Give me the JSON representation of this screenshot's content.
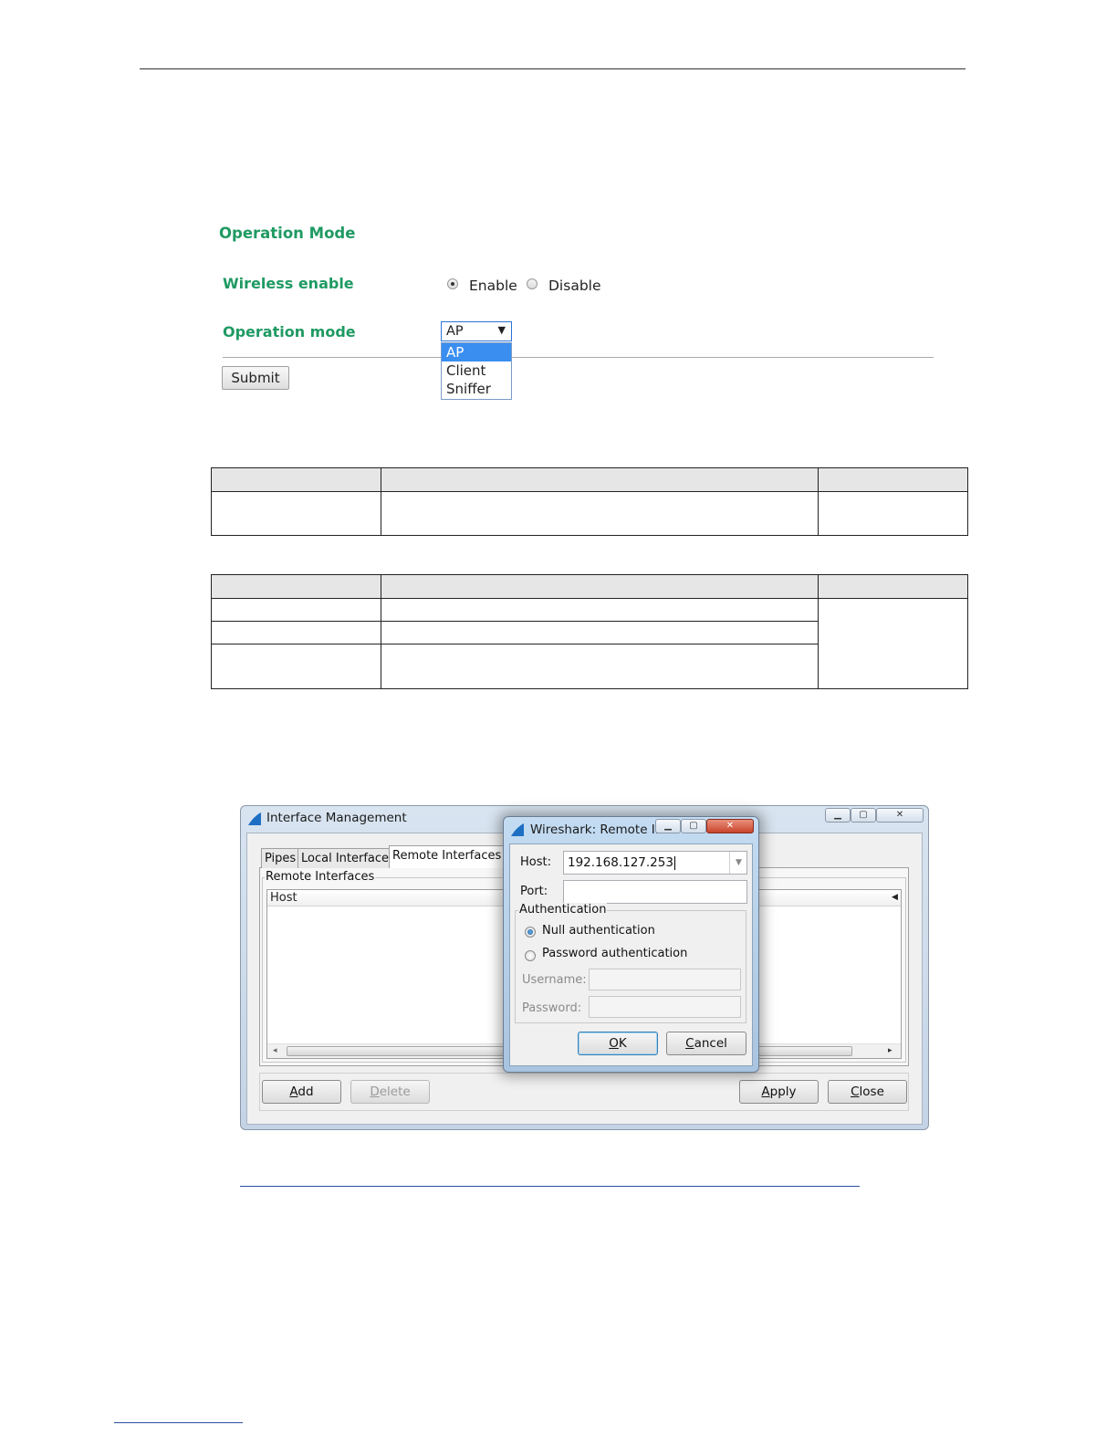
{
  "op_panel": {
    "title": "Operation Mode",
    "wireless_label": "Wireless enable",
    "enable_label": "Enable",
    "disable_label": "Disable",
    "wireless_selected": "Enable",
    "mode_label": "Operation mode",
    "mode_value": "AP",
    "mode_options": [
      "AP",
      "Client",
      "Sniffer"
    ],
    "submit_label": "Submit"
  },
  "interface_window": {
    "title": "Interface Management",
    "tabs": [
      "Pipes",
      "Local Interfaces",
      "Remote Interfaces"
    ],
    "active_tab": "Remote Interfaces",
    "group_label": "Remote Interfaces",
    "column_header": "Host",
    "buttons": {
      "add": {
        "hot": "A",
        "rest": "dd"
      },
      "delete": {
        "hot": "D",
        "rest": "elete"
      },
      "apply": {
        "hot": "A",
        "rest": "pply"
      },
      "close": {
        "hot": "C",
        "rest": "lose"
      }
    }
  },
  "remote_dialog": {
    "title": "Wireshark: Remote I...",
    "host_label": "Host:",
    "host_value": "192.168.127.253",
    "port_label": "Port:",
    "port_value": "",
    "auth_group": "Authentication",
    "null_auth": "Null authentication",
    "password_auth": "Password authentication",
    "selected_auth": "Null authentication",
    "username_label": "Username:",
    "password_label": "Password:",
    "ok": {
      "hot": "O",
      "rest": "K"
    },
    "cancel": {
      "hot": "C",
      "rest": "ancel"
    }
  },
  "icons": {
    "app": "wireshark-fin-icon",
    "minimize": "minimize-icon",
    "maximize": "maximize-icon",
    "close": "close-icon",
    "dropdown": "chevron-down-icon"
  }
}
